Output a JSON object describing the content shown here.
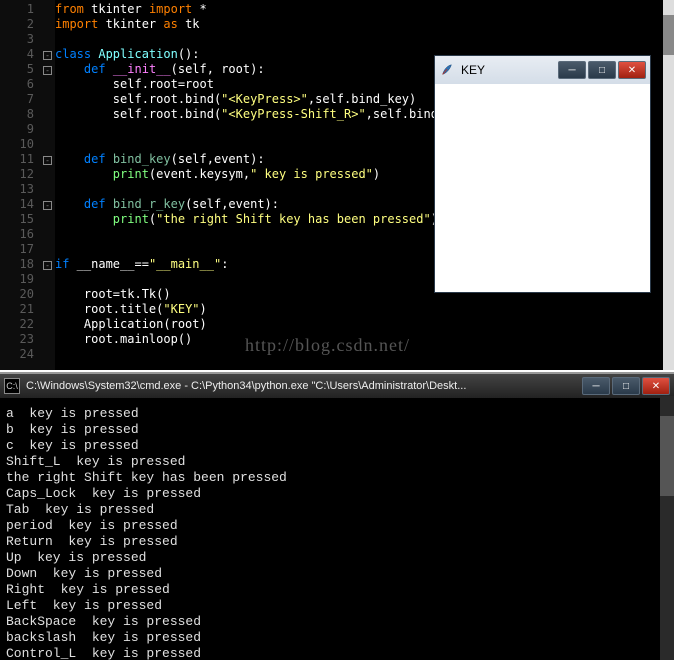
{
  "editor": {
    "lines": [
      1,
      2,
      3,
      4,
      5,
      6,
      7,
      8,
      9,
      10,
      11,
      12,
      13,
      14,
      15,
      16,
      17,
      18,
      19,
      20,
      21,
      22,
      23,
      24
    ],
    "fold_markers": {
      "4": "-",
      "5": "-",
      "11": "-",
      "14": "-",
      "18": "-"
    }
  },
  "code": {
    "l1_from": "from",
    "l1_tk": " tkinter ",
    "l1_import": "import",
    "l1_star": " *",
    "l2_import": "import",
    "l2_tk": " tkinter ",
    "l2_as": "as",
    "l2_alias": " tk",
    "l4_class": "class",
    "l4_name": " Application",
    "l4_p": "():",
    "l5_def": "def",
    "l5_name": " __init__",
    "l5_args": "(self, root):",
    "l6": "self.root=root",
    "l7_a": "self.root.bind(",
    "l7_s": "\"<KeyPress>\"",
    "l7_b": ",self.bind_key)",
    "l8_a": "self.root.bind(",
    "l8_s": "\"<KeyPress-Shift_R>\"",
    "l8_b": ",self.bind_r_key)",
    "l11_def": "def",
    "l11_name": " bind_key",
    "l11_args": "(self,event):",
    "l12_a": "print",
    "l12_b": "(event.keysym,",
    "l12_s": "\" key is pressed\"",
    "l12_c": ")",
    "l14_def": "def",
    "l14_name": " bind_r_key",
    "l14_args": "(self,event):",
    "l15_a": "print",
    "l15_b": "(",
    "l15_s": "\"the right Shift key has been pressed\"",
    "l15_c": ")",
    "l18_if": "if",
    "l18_a": " __name__==",
    "l18_s": "\"__main__\"",
    "l18_b": ":",
    "l20_a": "root=tk.Tk()",
    "l21_a": "root.title(",
    "l21_s": "\"KEY\"",
    "l21_b": ")",
    "l22": "Application(root)",
    "l23_a": "root.mainloop()"
  },
  "watermark": "http://blog.csdn.net/",
  "key_window": {
    "title": "KEY"
  },
  "console": {
    "title": "C:\\Windows\\System32\\cmd.exe - C:\\Python34\\python.exe  \"C:\\Users\\Administrator\\Deskt...",
    "output": "a  key is pressed\nb  key is pressed\nc  key is pressed\nShift_L  key is pressed\nthe right Shift key has been pressed\nCaps_Lock  key is pressed\nTab  key is pressed\nperiod  key is pressed\nReturn  key is pressed\nUp  key is pressed\nDown  key is pressed\nRight  key is pressed\nLeft  key is pressed\nBackSpace  key is pressed\nbackslash  key is pressed\nControl_L  key is pressed"
  },
  "win_buttons": {
    "min": "─",
    "max": "□",
    "close": "✕"
  }
}
